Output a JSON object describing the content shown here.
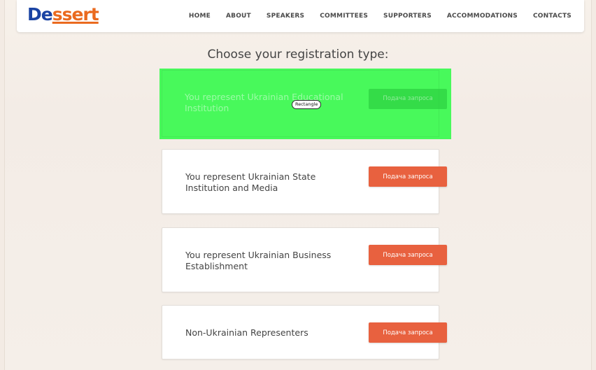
{
  "logo": {
    "part1": "De",
    "part2": "ssert"
  },
  "nav": {
    "items": [
      "HOME",
      "ABOUT",
      "SPEAKERS",
      "COMMITTEES",
      "SUPPORTERS",
      "ACCOMMODATIONS",
      "CONTACTS"
    ]
  },
  "main": {
    "title": "Choose your registration type:",
    "cards": [
      {
        "label": "You represent Ukrainian Educational Institution",
        "button": "Подача запроса"
      },
      {
        "label": "You represent Ukrainian State Institution and Media",
        "button": "Подача запроса"
      },
      {
        "label": "You represent Ukrainian Business Establishment",
        "button": "Подача запроса"
      },
      {
        "label": "Non-Ukrainian Representers",
        "button": "Подача запроса"
      }
    ]
  },
  "overlay": {
    "tag": "Rectangle",
    "color": "#30fa48"
  },
  "colors": {
    "accent": "#e8613f",
    "logo_blue": "#1a43a3",
    "logo_orange": "#ea6a1f"
  }
}
